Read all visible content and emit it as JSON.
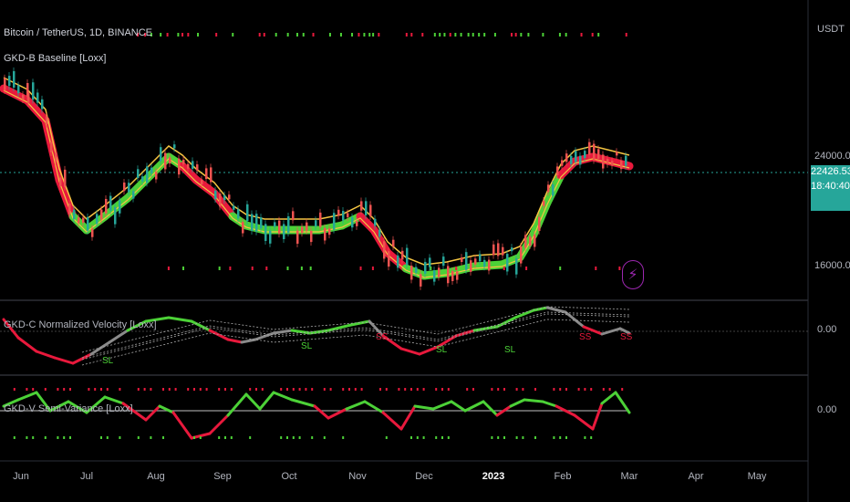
{
  "header": {
    "symbol_title": "Bitcoin / TetherUS, 1D, BINANCE",
    "indicator1": "GKD-B Baseline [Loxx]"
  },
  "panes": {
    "velocity_title": "GKD-C Normalized Velocity [Loxx]",
    "variance_title": "GKD-V Semi-Variance [Loxx]"
  },
  "price_axis": {
    "currency": "USDT",
    "level_high": "24000.00",
    "level_low": "16000.00",
    "current_price": "22426.53",
    "countdown": "18:40:40",
    "pane2_zero": "0.00",
    "pane3_zero": "0.00"
  },
  "time_axis": {
    "ticks": [
      "Jun",
      "Jul",
      "Aug",
      "Sep",
      "Oct",
      "Nov",
      "Dec",
      "2023",
      "Feb",
      "Mar",
      "Apr",
      "May"
    ]
  },
  "signals": {
    "sl_label": "SL",
    "ss_label": "SS"
  },
  "colors": {
    "bull": "#4cd137",
    "bear": "#e8193c",
    "baseline": "#f5c542",
    "grey_line": "#8a8a8a",
    "price_tag": "#26a69a",
    "divider": "#434651"
  },
  "icons": {
    "alert": "lightning-bolt-icon"
  }
}
